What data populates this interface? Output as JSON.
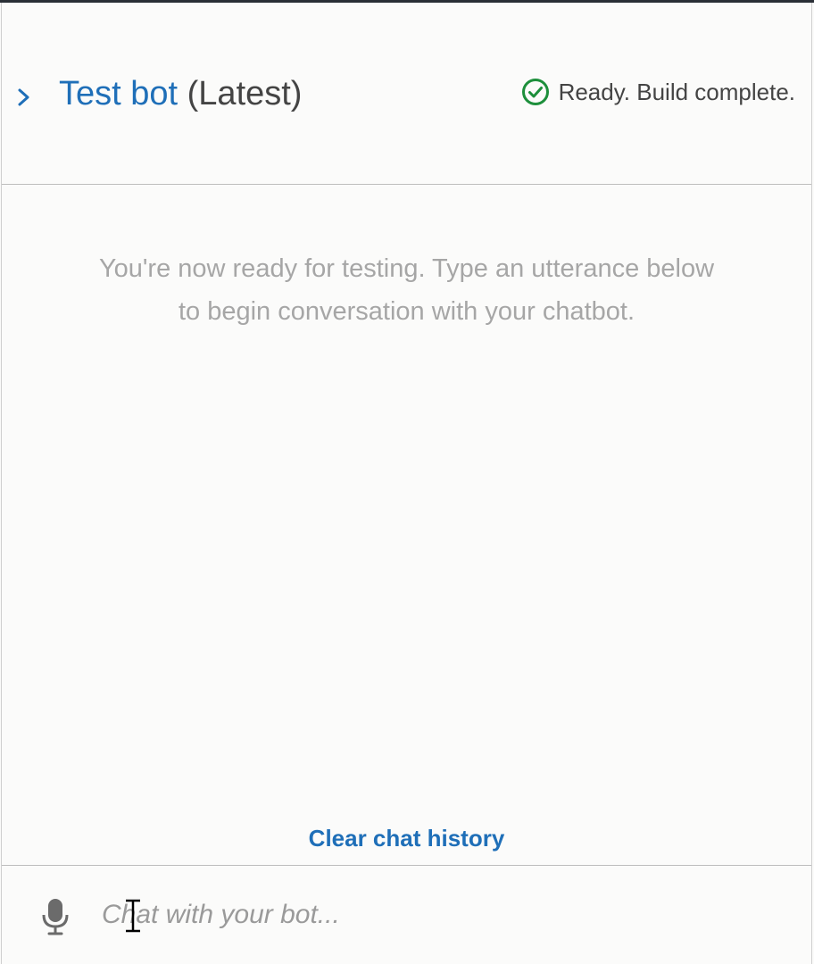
{
  "header": {
    "bot_name": "Test bot",
    "version": "(Latest)",
    "status_text": "Ready. Build complete.",
    "icons": {
      "expand": "chevron-right-icon",
      "status": "check-circle-icon"
    }
  },
  "chat": {
    "empty_line1": "You're now ready for testing. Type an utterance below",
    "empty_line2": "to begin conversation with your chatbot.",
    "clear_history_label": "Clear chat history"
  },
  "input": {
    "placeholder": "Chat with your bot...",
    "value": "",
    "icons": {
      "mic": "microphone-icon"
    }
  },
  "colors": {
    "accent": "#1f6fb8",
    "success": "#1d8f3b",
    "muted_text": "#a6a6a6",
    "background": "#fbfbfa"
  }
}
